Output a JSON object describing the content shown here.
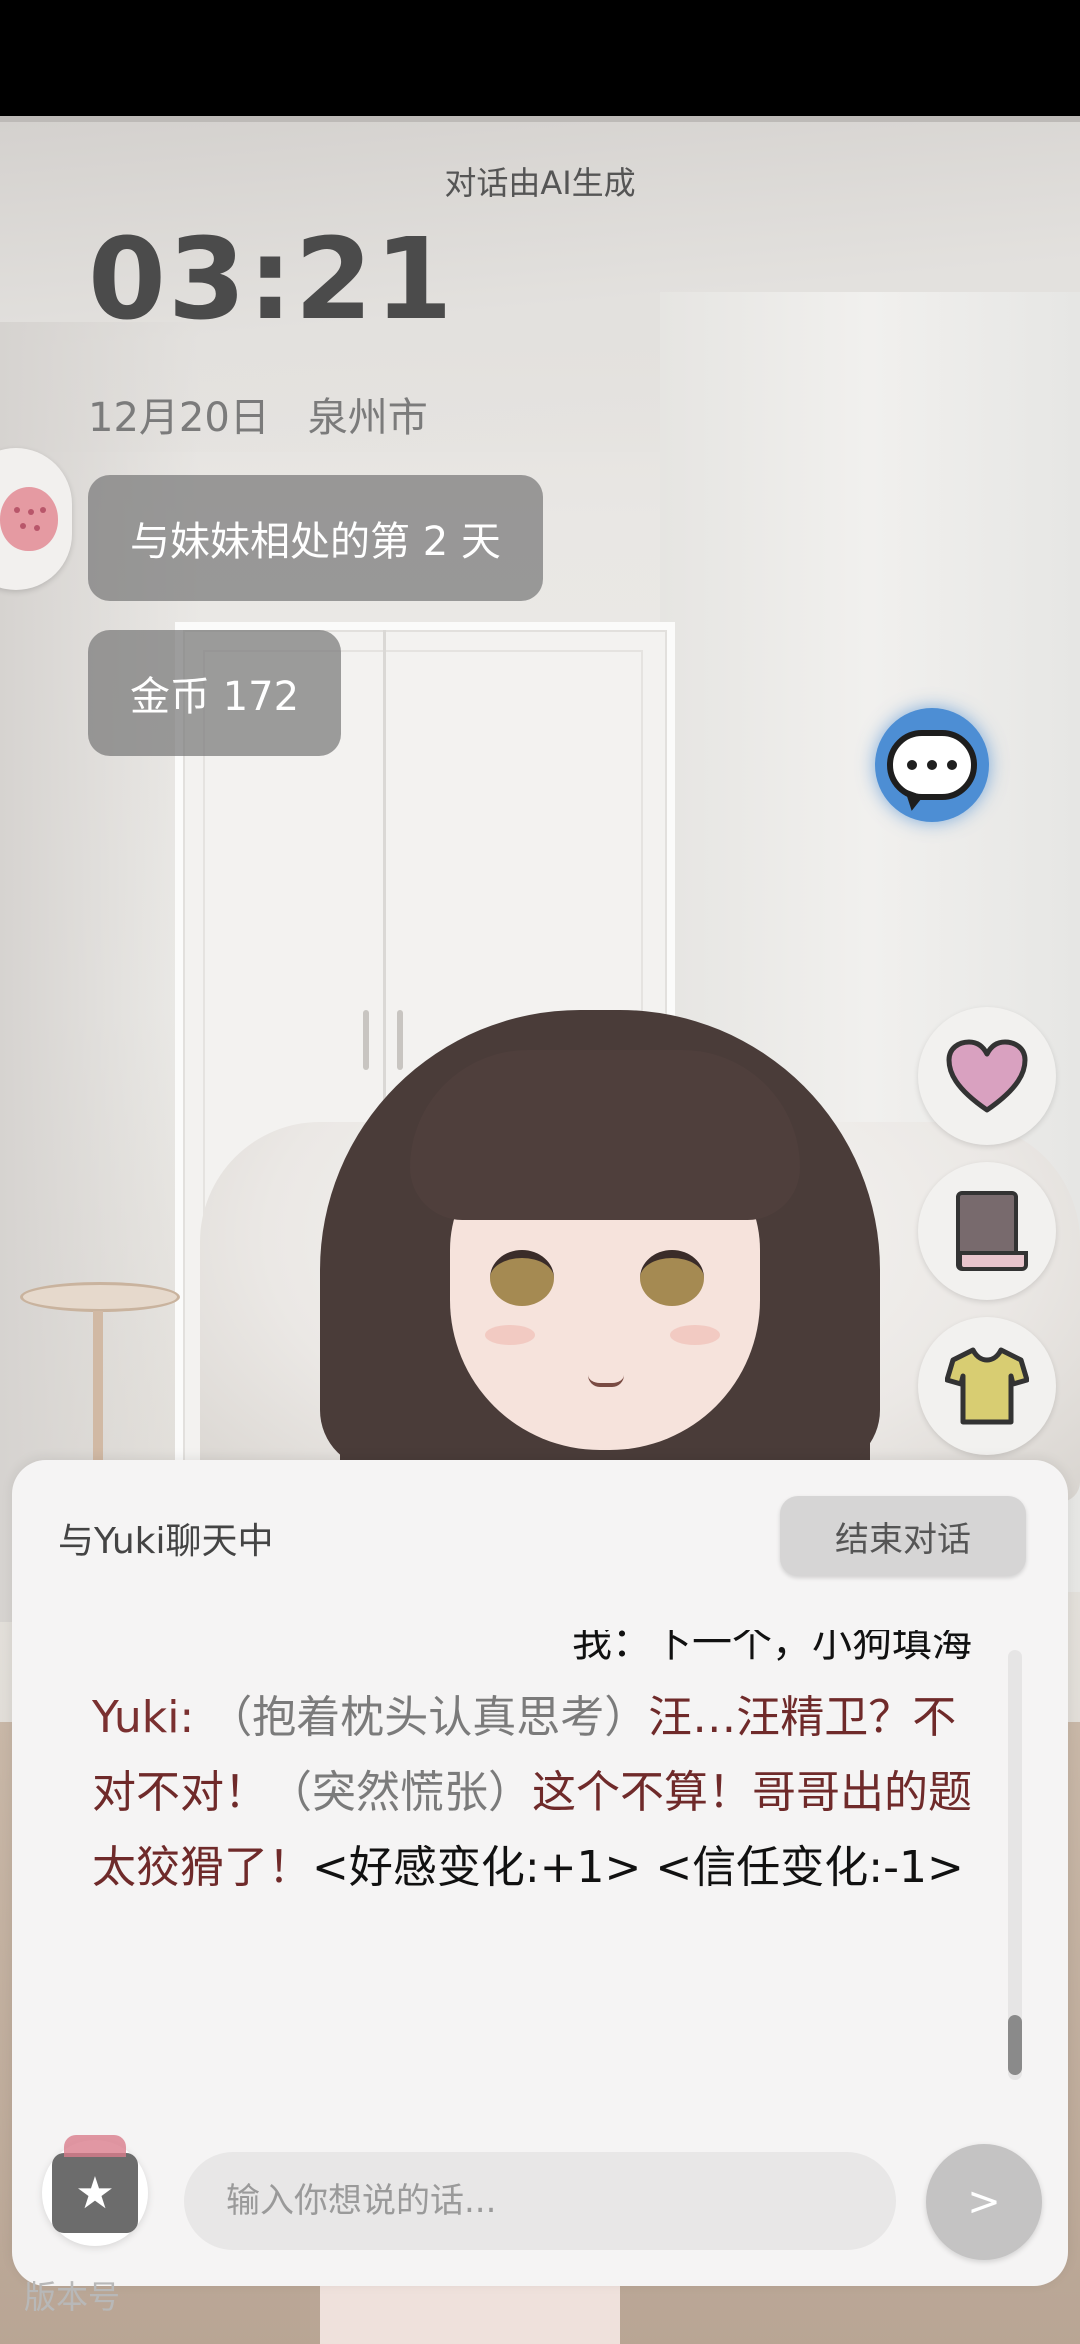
{
  "header": {
    "ai_note": "对话由AI生成"
  },
  "clock": {
    "time": "03:21",
    "date": "12月20日",
    "city": "泉州市"
  },
  "stats": {
    "days_label": "与妹妹相处的第 2 天",
    "coins_label": "金币 172"
  },
  "icons": {
    "avatar": "strawberry-icon",
    "chat": "speech-bubble-icon",
    "heart": "heart-icon",
    "book": "book-icon",
    "outfit": "shirt-icon",
    "gift": "gift-icon"
  },
  "colors": {
    "accent_blue": "#4d8ed4",
    "ai_text": "#6f2a2a",
    "panel_bg": "#f5f4f4"
  },
  "chat": {
    "title": "与Yuki聊天中",
    "end_button": "结束对话",
    "user_message": "我：下一个，小狗填海",
    "ai_message": {
      "speaker": "Yuki:",
      "action1": "（抱着枕头认真思考）",
      "text1": "汪…汪精卫？不对不对！",
      "action2": "（突然慌张）",
      "text2": "这个不算！哥哥出的题太狡猾了！",
      "tags": "<好感变化:+1> <信任变化:-1>"
    },
    "input_placeholder": "输入你想说的话...",
    "send_label": ">"
  },
  "footer": {
    "version": "版本号"
  }
}
